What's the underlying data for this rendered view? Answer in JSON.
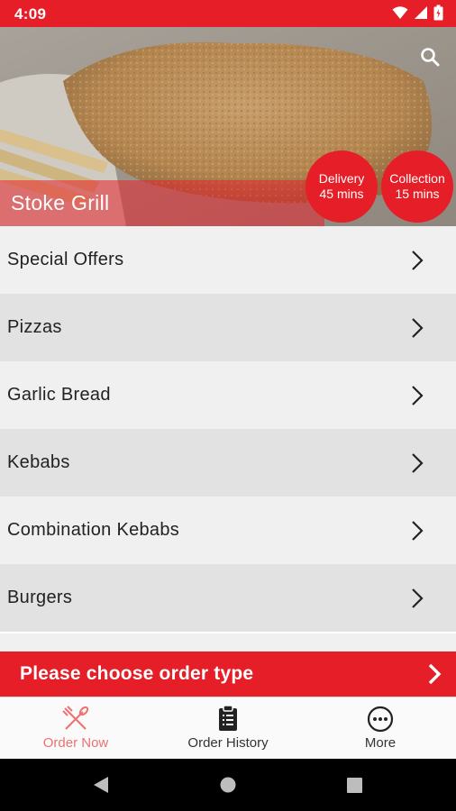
{
  "status_bar": {
    "time": "4:09"
  },
  "hero": {
    "restaurant_name": "Stoke Grill",
    "search_icon": "search-icon",
    "delivery": {
      "label": "Delivery",
      "time": "45 mins"
    },
    "collection": {
      "label": "Collection",
      "time": "15 mins"
    }
  },
  "menu": {
    "items": [
      {
        "label": "Special Offers"
      },
      {
        "label": "Pizzas"
      },
      {
        "label": "Garlic Bread"
      },
      {
        "label": "Kebabs"
      },
      {
        "label": "Combination Kebabs"
      },
      {
        "label": "Burgers"
      }
    ]
  },
  "order_bar": {
    "label": "Please choose order type"
  },
  "bottom_nav": {
    "order_now": "Order Now",
    "order_history": "Order History",
    "more": "More"
  },
  "colors": {
    "accent": "#e61e27",
    "active_nav": "#f07070",
    "text": "#222222"
  }
}
